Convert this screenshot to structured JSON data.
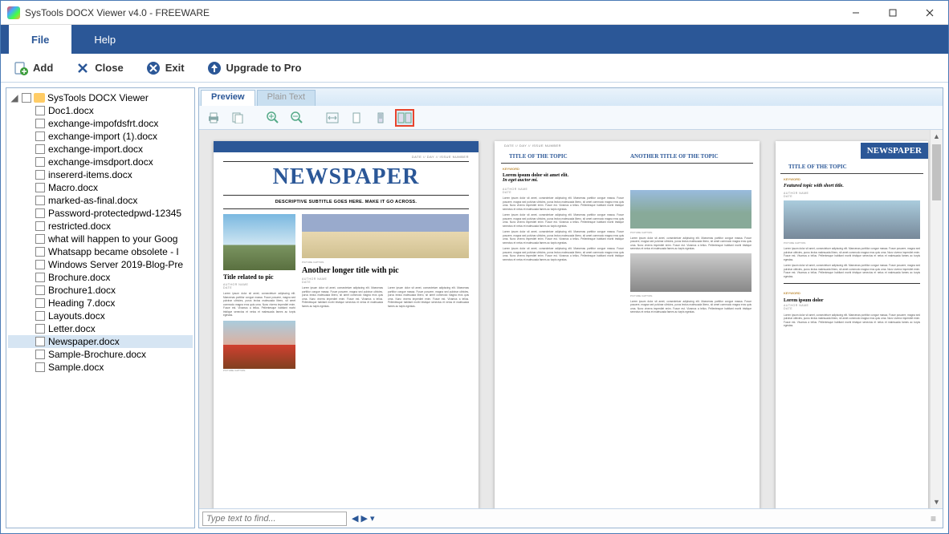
{
  "window": {
    "title": "SysTools DOCX Viewer v4.0 - FREEWARE"
  },
  "menus": {
    "file": "File",
    "help": "Help"
  },
  "toolbar": {
    "add": "Add",
    "close": "Close",
    "exit": "Exit",
    "upgrade": "Upgrade to Pro"
  },
  "tree": {
    "root": "SysTools DOCX Viewer",
    "items": [
      "Doc1.docx",
      "exchange-impofdsfrt.docx",
      "exchange-import (1).docx",
      "exchange-import.docx",
      "exchange-imsdport.docx",
      "insererd-items.docx",
      "Macro.docx",
      "marked-as-final.docx",
      "Password-protectedpwd-12345",
      "restricted.docx",
      "what will happen to your Goog",
      "Whatsapp became obsolete - I",
      "Windows Server 2019-Blog-Pre",
      "Brochure.docx",
      "Brochure1.docx",
      "Heading 7.docx",
      "Layouts.docx",
      "Letter.docx",
      "Newspaper.docx",
      "Sample-Brochure.docx",
      "Sample.docx"
    ],
    "selected_index": 18
  },
  "tabs": {
    "preview": "Preview",
    "plain": "Plain Text"
  },
  "doc": {
    "meta": "DATE  //  DAY  //  ISSUE NUMBER",
    "masthead": "NEWSPAPER",
    "subtitle": "DESCRIPTIVE SUBTITLE GOES HERE.  MAKE IT GO ACROSS.",
    "h_related": "Title related to pic",
    "h_longer": "Another longer title with pic",
    "author": "AUTHOR NAME",
    "date": "DATE",
    "caption": "PICTURE CAPTION.",
    "lorem": "Lorem ipsum dolor sit amet, consectetuer adipiscing elit. Maecenas porttitor congue massa. Fusce posuere, magna sed pulvinar ultricies, purus lectus malesuada libero, sit amet commodo magna eros quis urna. Nunc viverra imperdiet enim. Fusce est. Vivamus a tellus. Pellentesque habitant morbi tristique senectus et netus et malesuada fames ac turpis egestas.",
    "topic1": "TITLE OF THE TOPIC",
    "topic2": "ANOTHER TITLE OF THE TOPIC",
    "topic3": "TITLE OF THE TOPIC",
    "keyword": "KEYWORD",
    "lead1": "Lorem ipsum dolor sit amet elit.",
    "lead1_em": "In eget auctor mi.",
    "lead2": "Featured topic with short title.",
    "lead3": "Lorem ipsum dolor"
  },
  "find": {
    "placeholder": "Type text to find..."
  }
}
